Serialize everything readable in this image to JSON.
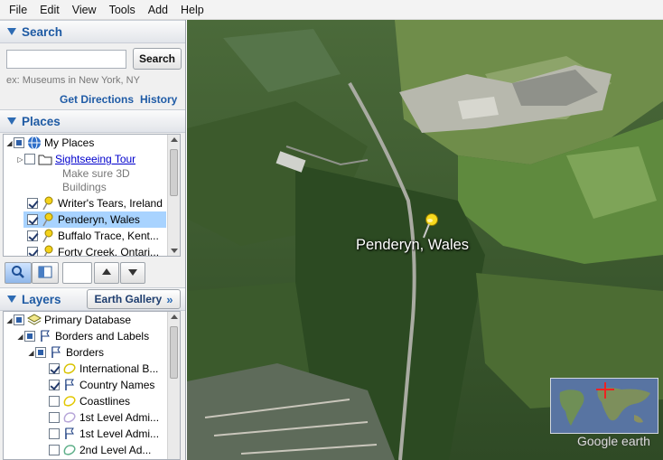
{
  "menu": [
    "File",
    "Edit",
    "View",
    "Tools",
    "Add",
    "Help"
  ],
  "search": {
    "title": "Search",
    "input_value": "",
    "button": "Search",
    "hint": "ex: Museums in New York, NY",
    "get_directions": "Get Directions",
    "history": "History"
  },
  "places": {
    "title": "Places",
    "items": [
      {
        "label": "My Places",
        "icon": "globe-icon"
      },
      {
        "label": "Sightseeing Tour",
        "icon": "folder-icon"
      },
      {
        "label": "Make sure 3D",
        "icon": ""
      },
      {
        "label": "Buildings",
        "icon": ""
      },
      {
        "label": "Writer's Tears, Ireland",
        "icon": "pushpin-icon"
      },
      {
        "label": "Penderyn, Wales",
        "icon": "pushpin-icon"
      },
      {
        "label": "Buffalo Trace, Kent...",
        "icon": "pushpin-icon"
      },
      {
        "label": "Forty Creek, Ontari...",
        "icon": "pushpin-icon"
      }
    ]
  },
  "layers": {
    "title": "Layers",
    "gallery_button": "Earth Gallery",
    "items": [
      {
        "label": "Primary Database",
        "icon": "layers-icon"
      },
      {
        "label": "Borders and Labels",
        "icon": "flag-icon"
      },
      {
        "label": "Borders",
        "icon": "flag-icon"
      },
      {
        "label": "International B...",
        "icon": "border-icon"
      },
      {
        "label": "Country Names",
        "icon": "flag-icon"
      },
      {
        "label": "Coastlines",
        "icon": "border-icon"
      },
      {
        "label": "1st Level Admi...",
        "icon": "border-icon"
      },
      {
        "label": "1st Level Admi...",
        "icon": "flag-icon"
      },
      {
        "label": "2nd Level Ad...",
        "icon": "border-icon"
      }
    ]
  },
  "map": {
    "placemark_label": "Penderyn, Wales",
    "brand": "Google earth"
  }
}
